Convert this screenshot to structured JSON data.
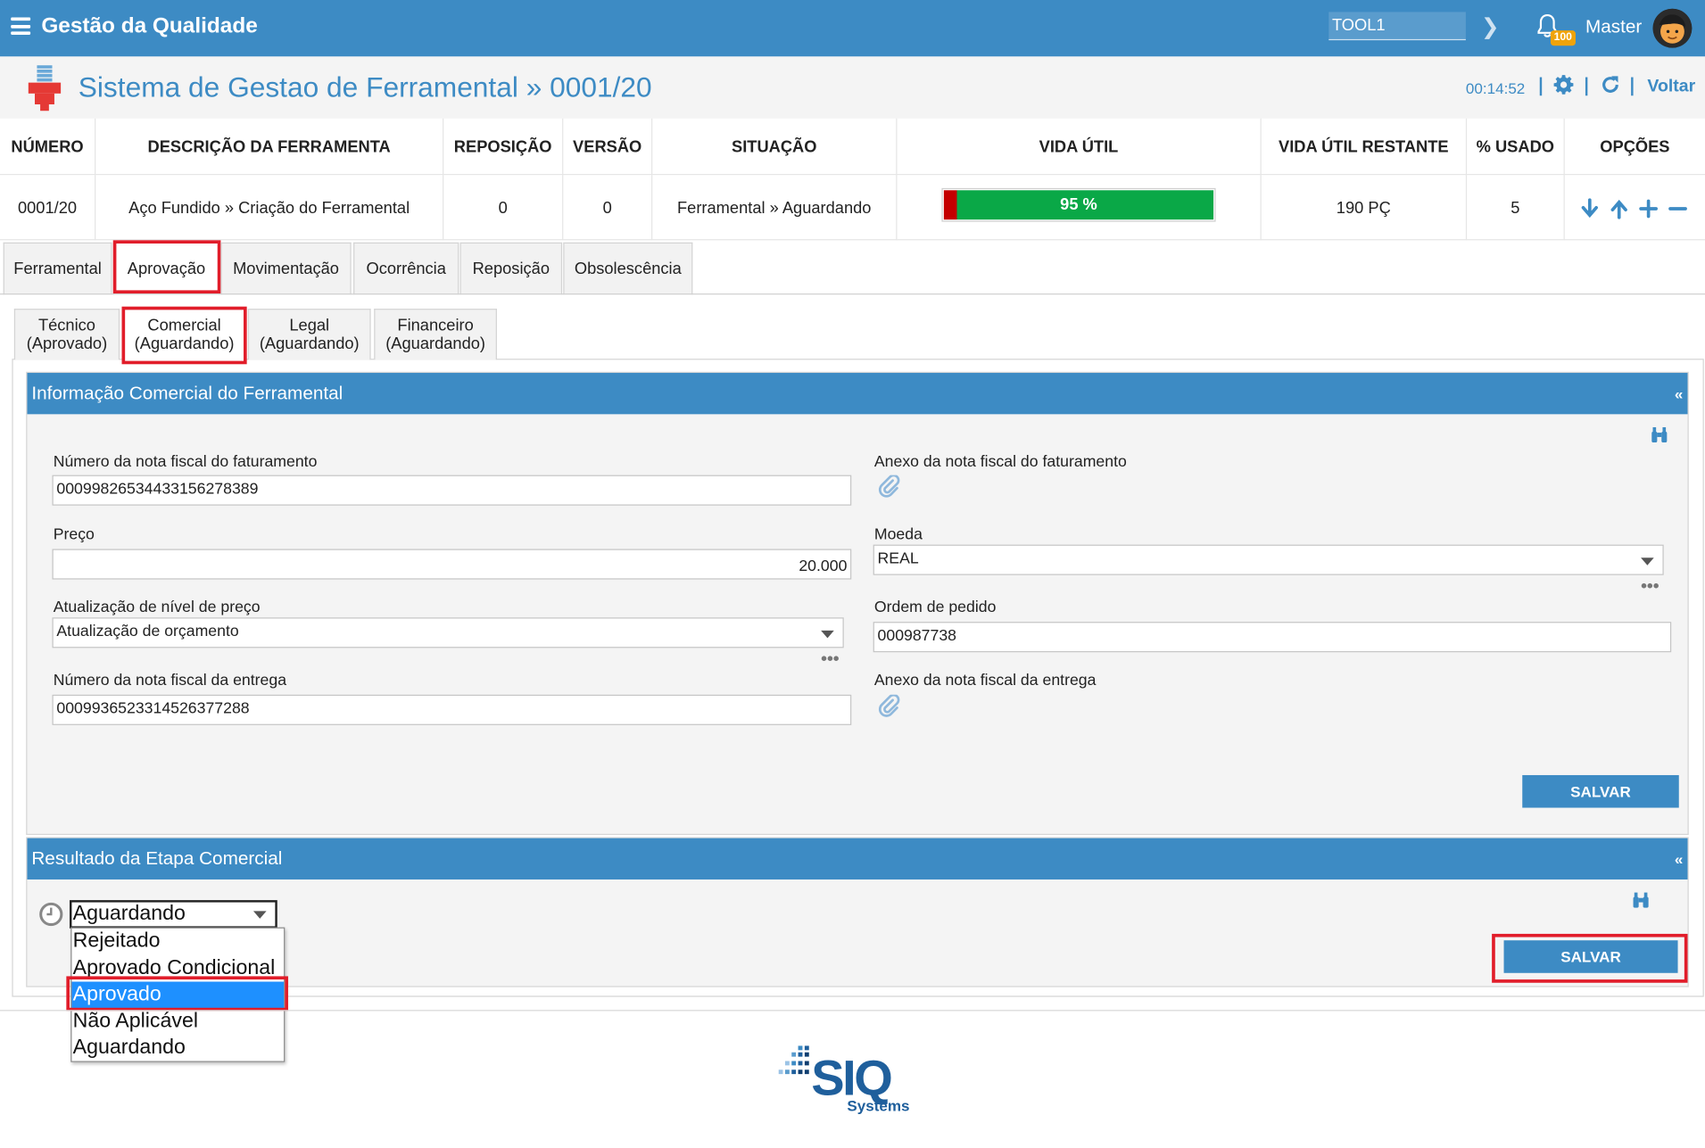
{
  "app": {
    "title": "Gestão da Qualidade"
  },
  "topbar": {
    "tool_value": "TOOL1",
    "notifications_count": "100",
    "user": "Master"
  },
  "header": {
    "title": "Sistema de Gestao de Ferramental » 0001/20",
    "timer": "00:14:52",
    "back_label": "Voltar"
  },
  "table": {
    "headers": [
      "NÚMERO",
      "DESCRIÇÃO DA FERRAMENTA",
      "REPOSIÇÃO",
      "VERSÃO",
      "SITUAÇÃO",
      "VIDA ÚTIL",
      "VIDA ÚTIL RESTANTE",
      "% USADO",
      "OPÇÕES"
    ],
    "row": {
      "numero": "0001/20",
      "descricao": "Aço Fundido » Criação do Ferramental",
      "reposicao": "0",
      "versao": "0",
      "situacao": "Ferramental » Aguardando",
      "vida_util": "95 %",
      "vida_util_pct": 0.95,
      "vida_restante": "190 PÇ",
      "usado": "5"
    }
  },
  "tabs": [
    "Ferramental",
    "Aprovação",
    "Movimentação",
    "Ocorrência",
    "Reposição",
    "Obsolescência"
  ],
  "subtabs": [
    {
      "line1": "Técnico",
      "line2": "(Aprovado)"
    },
    {
      "line1": "Comercial",
      "line2": "(Aguardando)"
    },
    {
      "line1": "Legal",
      "line2": "(Aguardando)"
    },
    {
      "line1": "Financeiro",
      "line2": "(Aguardando)"
    }
  ],
  "panel_info": {
    "title": "Informação Comercial do Ferramental",
    "collapse": "«",
    "nf_faturamento_label": "Número da nota fiscal do faturamento",
    "nf_faturamento_value": "0009982653443315627838​9",
    "anexo_faturamento_label": "Anexo da nota fiscal do faturamento",
    "preco_label": "Preço",
    "preco_value": "20.000",
    "moeda_label": "Moeda",
    "moeda_value": "REAL",
    "atualizacao_label": "Atualização de nível de preço",
    "atualizacao_value": "Atualização de orçamento",
    "ordem_label": "Ordem de pedido",
    "ordem_value": "000987738",
    "nf_entrega_label": "Número da nota fiscal da entrega",
    "nf_entrega_value": "00099365233145263772​88",
    "anexo_entrega_label": "Anexo da nota fiscal da entrega",
    "more": "•••",
    "save_label": "SALVAR"
  },
  "panel_result": {
    "title": "Resultado da Etapa Comercial",
    "collapse": "«",
    "selected": "Aguardando",
    "options": [
      "Rejeitado",
      "Aprovado Condicional",
      "Aprovado",
      "Não Aplicável",
      "Aguardando"
    ],
    "highlighted_option": "Aprovado",
    "save_label": "SALVAR"
  },
  "footer": {
    "brand": "SIQ",
    "brand_sub": "Systems"
  },
  "colors": {
    "primary": "#3d8bc4",
    "highlight": "#e11d2a",
    "progress_green": "#0aa847",
    "progress_red": "#c40000",
    "badge": "#f0a30a",
    "selected_option": "#1e90ff"
  }
}
